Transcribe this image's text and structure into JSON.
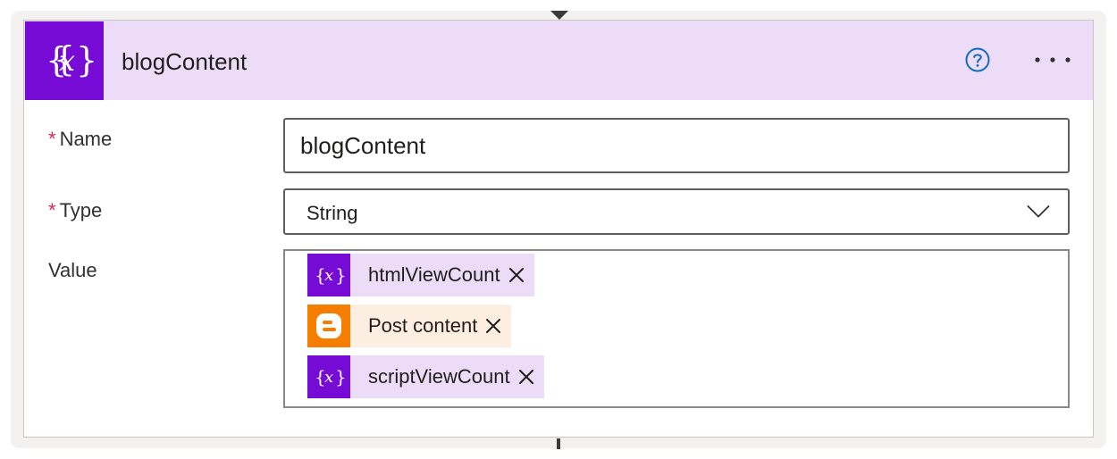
{
  "card": {
    "title": "blogContent",
    "header_color": "#ecdcf7",
    "icon": "variable-icon",
    "icon_color": "#770bd6",
    "help_icon": "help-circle-icon",
    "more_icon": "more-options-icon"
  },
  "fields": {
    "name": {
      "required_marker": "*",
      "label": "Name",
      "value": "blogContent"
    },
    "type": {
      "required_marker": "*",
      "label": "Type",
      "selected": "String"
    },
    "value": {
      "label": "Value",
      "tokens": [
        {
          "label": "htmlViewCount",
          "kind": "variable",
          "icon": "variable-icon",
          "color": "#770bd6",
          "background": "#ecdcf7"
        },
        {
          "label": "Post content",
          "kind": "blogger",
          "icon": "blogger-icon",
          "color": "#f57d00",
          "background": "#fdeee2"
        },
        {
          "label": "scriptViewCount",
          "kind": "variable",
          "icon": "variable-icon",
          "color": "#770bd6",
          "background": "#ecdcf7"
        }
      ]
    }
  }
}
